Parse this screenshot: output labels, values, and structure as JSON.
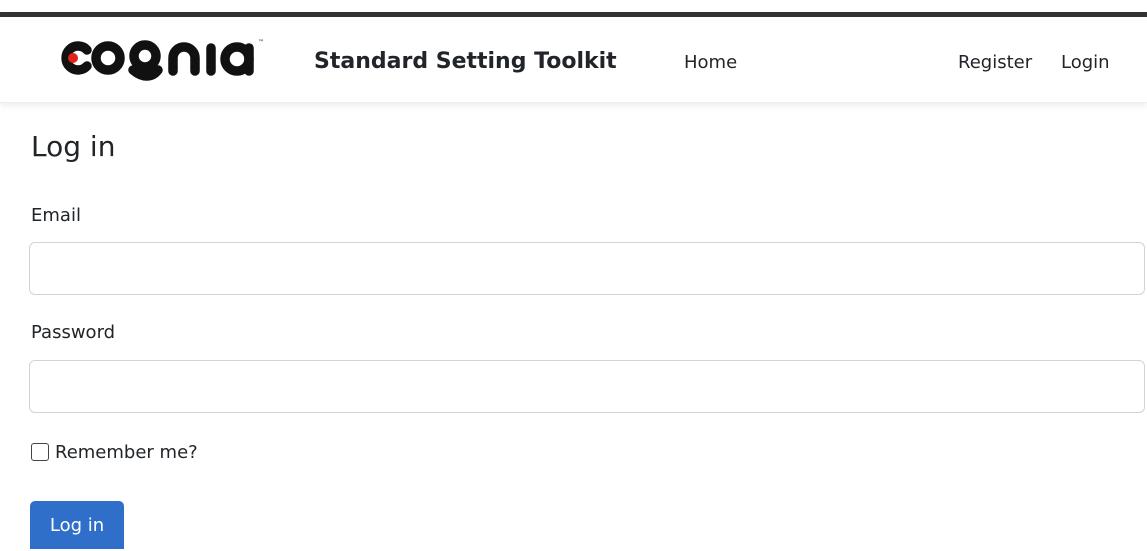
{
  "header": {
    "logo_text": "cognia",
    "brand_title": "Standard Setting Toolkit",
    "nav_home": "Home",
    "nav_register": "Register",
    "nav_login": "Login"
  },
  "form": {
    "title": "Log in",
    "email_label": "Email",
    "email_value": "",
    "password_label": "Password",
    "password_value": "",
    "remember_label": "Remember me?",
    "remember_checked": false,
    "submit_label": "Log in"
  },
  "colors": {
    "primary_button": "#2f6fc9",
    "top_border": "#333333",
    "text": "#212529",
    "input_border": "#ced4da"
  }
}
